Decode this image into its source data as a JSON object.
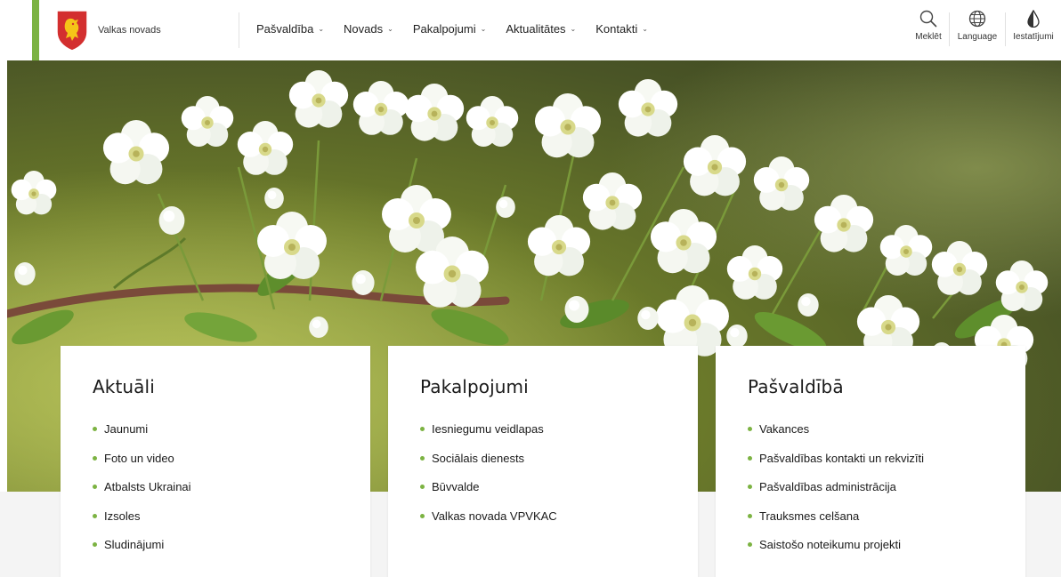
{
  "header": {
    "site_name": "Valkas novads",
    "nav": [
      {
        "label": "Pašvaldība"
      },
      {
        "label": "Novads"
      },
      {
        "label": "Pakalpojumi"
      },
      {
        "label": "Aktualitātes"
      },
      {
        "label": "Kontakti"
      }
    ],
    "tools": {
      "search_label": "Meklēt",
      "language_label": "Language",
      "settings_label": "Iestatījumi"
    }
  },
  "cards": [
    {
      "title": "Aktuāli",
      "links": [
        "Jaunumi",
        "Foto un video",
        "Atbalsts Ukrainai",
        "Izsoles",
        "Sludinājumi"
      ]
    },
    {
      "title": "Pakalpojumi",
      "links": [
        "Iesniegumu veidlapas",
        "Sociālais dienests",
        "Būvvalde",
        "Valkas novada VPVKAC"
      ]
    },
    {
      "title": "Pašvaldībā",
      "links": [
        "Vakances",
        "Pašvaldības kontakti un rekvizīti",
        "Pašvaldības administrācija",
        "Trauksmes celšana",
        "Saistošo noteikumu projekti"
      ]
    }
  ],
  "colors": {
    "accent": "#7cb342",
    "logo_shield": "#d32f2f",
    "logo_lion": "#f5c518"
  }
}
